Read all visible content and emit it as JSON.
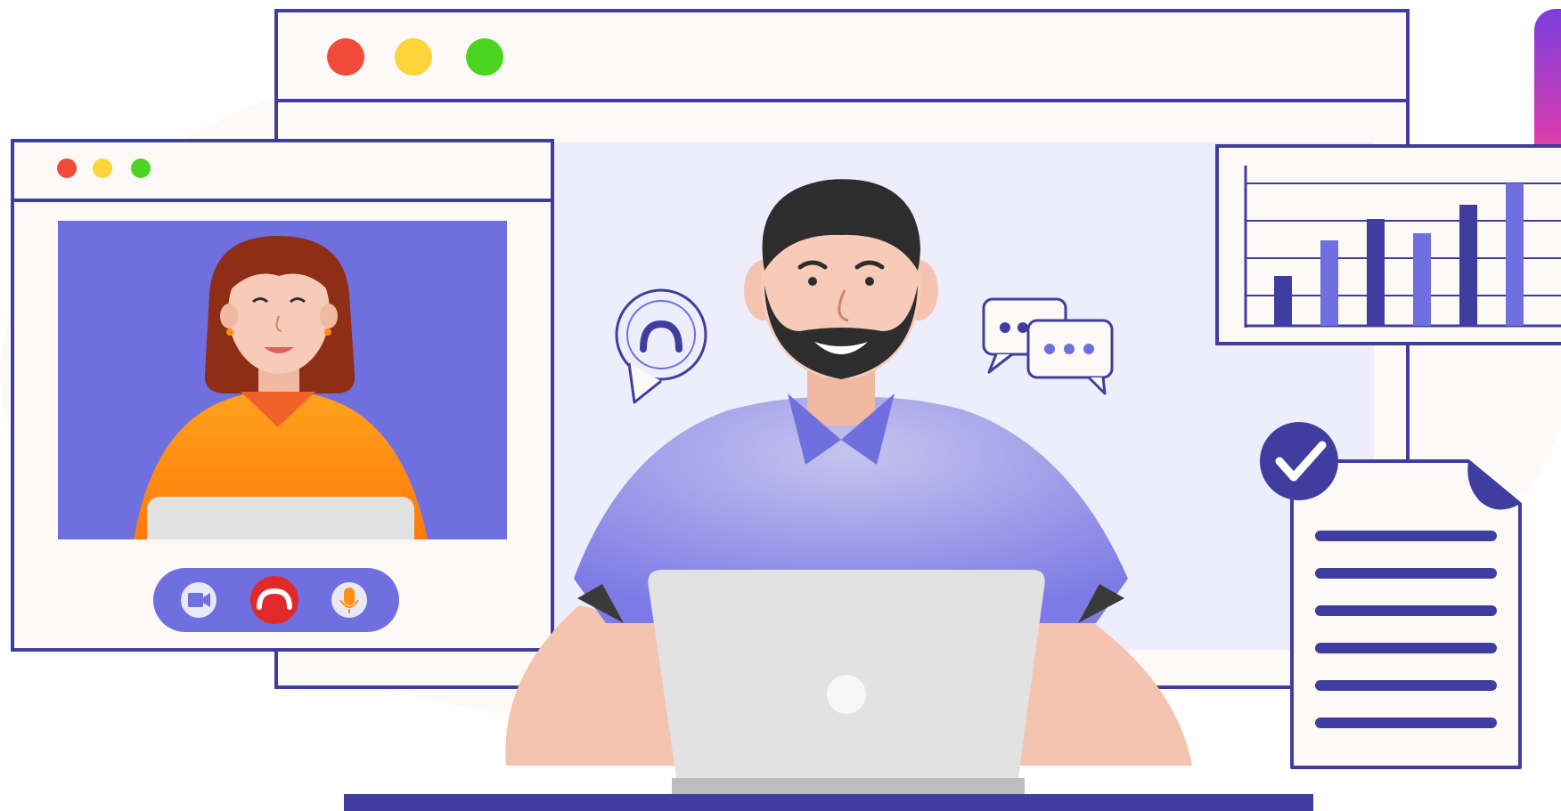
{
  "scene": {
    "colors": {
      "outline": "#3f3ea0",
      "accent_purple": "#6f6fe0",
      "panel_fill": "#fdf9f7",
      "screen_fill": "#eeedfb",
      "traffic_red": "#f24b3c",
      "traffic_yellow": "#fcd53a",
      "traffic_green": "#4cd421",
      "shirt_orange": "#ff8f10",
      "shirt_purple": "#8b8ae8",
      "hair_brown": "#8f2e16",
      "hair_black": "#2d2d2d",
      "skin": "#f4c4b0",
      "laptop_gray": "#e2e2e2",
      "hangup_red": "#e3282a"
    },
    "chart_bars": [
      0.35,
      0.6,
      0.75,
      0.65,
      0.85,
      1.0
    ],
    "document_lines": 6,
    "call_controls": [
      {
        "icon": "video-camera-icon"
      },
      {
        "icon": "hang-up-icon"
      },
      {
        "icon": "microphone-icon"
      }
    ]
  }
}
